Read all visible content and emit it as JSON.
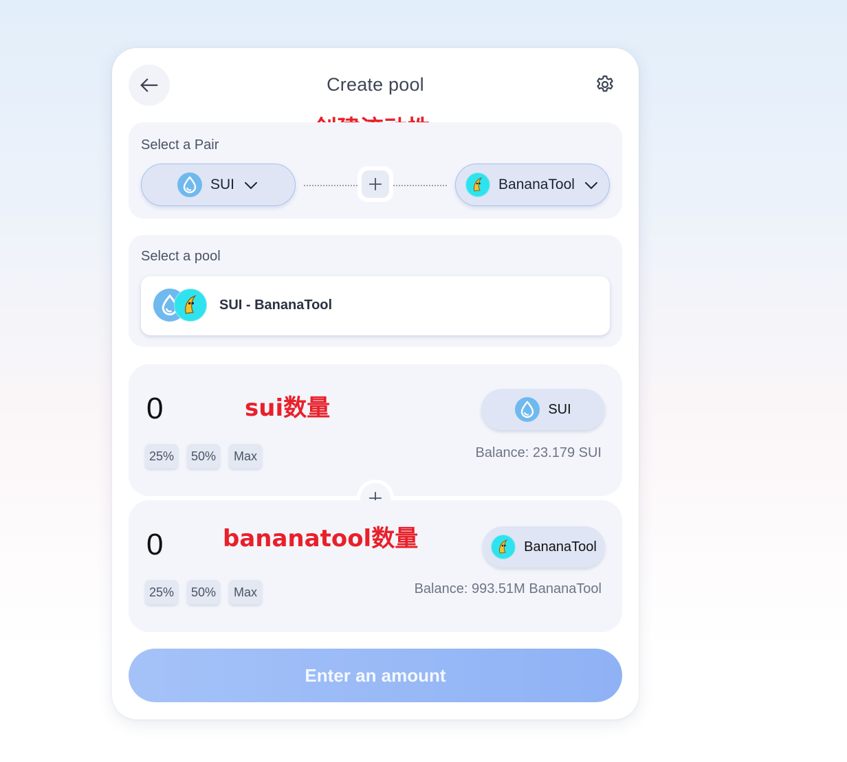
{
  "header": {
    "title": "Create pool",
    "title_annotation": "创建流动性"
  },
  "pair": {
    "label": "Select a Pair",
    "token_a": {
      "symbol": "SUI",
      "icon": "sui-drop-icon"
    },
    "token_b": {
      "symbol": "BananaTool",
      "icon": "bananatool-logo-icon"
    }
  },
  "pool": {
    "label": "Select a pool",
    "selected": "SUI - BananaTool"
  },
  "input_a": {
    "annotation": "sui数量",
    "value": "0",
    "token": "SUI",
    "pct_25": "25%",
    "pct_50": "50%",
    "max": "Max",
    "balance": "Balance: 23.179 SUI"
  },
  "input_b": {
    "annotation": "bananatool数量",
    "value": "0",
    "token": "BananaTool",
    "pct_25": "25%",
    "pct_50": "50%",
    "max": "Max",
    "balance": "Balance: 993.51M BananaTool"
  },
  "submit": {
    "label": "Enter an amount"
  },
  "colors": {
    "accent": "#8fb2f5",
    "annotation": "#e8202a",
    "panel": "#f3f5fb",
    "sui": "#6fb9ee",
    "banana": "#2fe3ee"
  }
}
